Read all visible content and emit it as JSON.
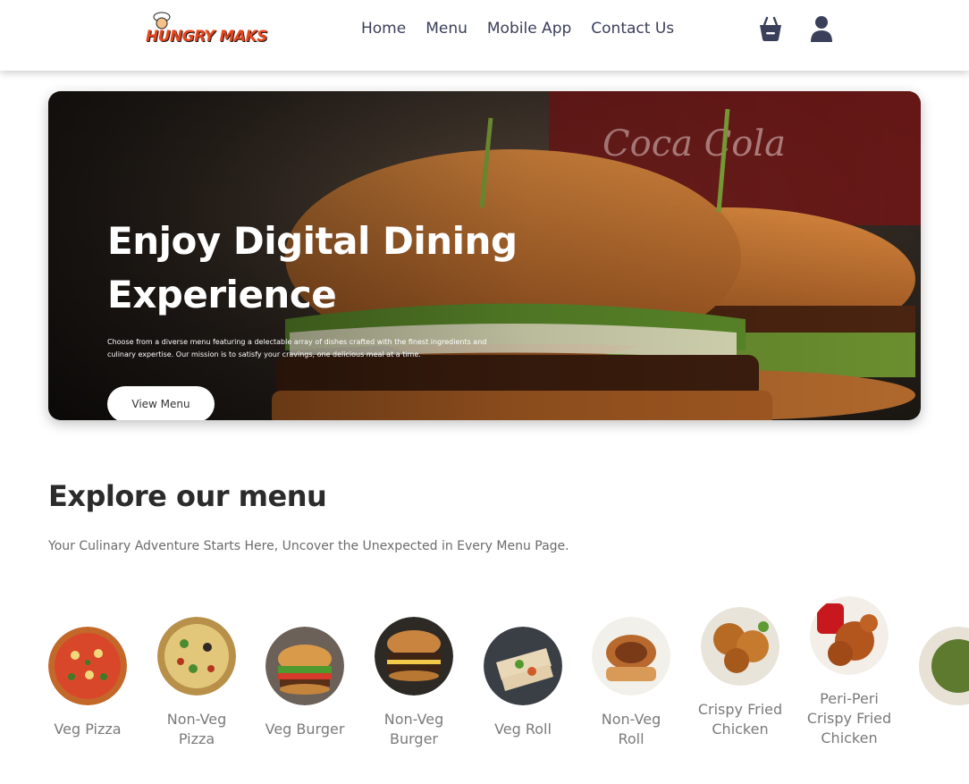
{
  "brand": {
    "logo_text": "HUNGRY MAKS"
  },
  "nav": {
    "links": [
      "Home",
      "Menu",
      "Mobile App",
      "Contact Us"
    ],
    "icons": [
      "basket-icon",
      "user-icon"
    ]
  },
  "hero": {
    "title": "Enjoy Digital Dining Experience",
    "description": "Choose from a diverse menu featuring a delectable array of dishes crafted with the finest ingredients and culinary expertise. Our mission is to satisfy your cravings, one delicious meal at a time.",
    "button_label": "View Menu"
  },
  "explore": {
    "title": "Explore our menu",
    "subtitle": "Your Culinary Adventure Starts Here, Uncover the Unexpected in Every Menu Page."
  },
  "menu_items": [
    {
      "label": "Veg Pizza"
    },
    {
      "label": "Non-Veg Pizza"
    },
    {
      "label": "Veg Burger"
    },
    {
      "label": "Non-Veg Burger"
    },
    {
      "label": "Veg Roll"
    },
    {
      "label": "Non-Veg Roll"
    },
    {
      "label": "Crispy Fried Chicken"
    },
    {
      "label": "Peri-Peri Crispy Fried Chicken"
    }
  ],
  "colors": {
    "accent": "#e8461e",
    "nav_text": "#3a3f5a",
    "icon": "#3a3f5a"
  }
}
